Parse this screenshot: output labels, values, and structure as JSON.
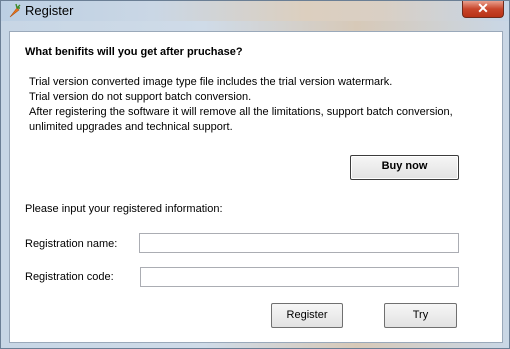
{
  "window": {
    "title": "Register",
    "close_glyph": "✕"
  },
  "content": {
    "heading": "What benifits will you get after pruchase?",
    "info_lines": [
      "Trial version converted image type file includes the trial version watermark.",
      "Trial version do not support batch conversion.",
      "After registering the software it will remove all the limitations, support batch conversion,",
      "unlimited upgrades and technical support."
    ],
    "buy_now_label": "Buy now",
    "prompt": "Please input your registered information:",
    "name_label": "Registration name:",
    "name_value": "",
    "code_label": "Registration code:",
    "code_value": "",
    "register_label": "Register",
    "try_label": "Try"
  },
  "icons": {
    "app": "carrot-icon",
    "close": "close-icon"
  },
  "colors": {
    "close_button": "#c8452b",
    "client_background": "#ffffff"
  }
}
